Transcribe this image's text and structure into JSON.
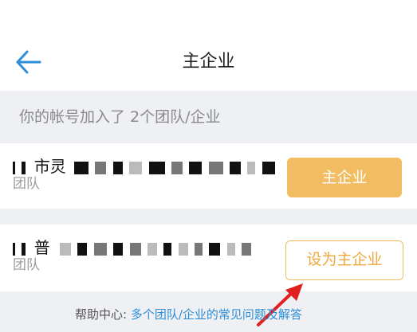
{
  "header": {
    "title": "主企业",
    "back_icon": "arrow-left-icon",
    "back_color": "#2e8fd8"
  },
  "summary": {
    "text": "你的帐号加入了 2个团队/企业"
  },
  "organizations": [
    {
      "name_visible": "市灵",
      "type": "团队",
      "action_label": "主企业",
      "action_state": "current"
    },
    {
      "name_visible": "普",
      "type": "团队",
      "action_label": "设为主企业",
      "action_state": "set"
    }
  ],
  "help": {
    "prefix": "帮助中心:",
    "link": "多个团队/企业的常见问题及解答"
  },
  "colors": {
    "accent": "#f2bd62",
    "link": "#2e8fd8",
    "annotation": "#e02020"
  }
}
